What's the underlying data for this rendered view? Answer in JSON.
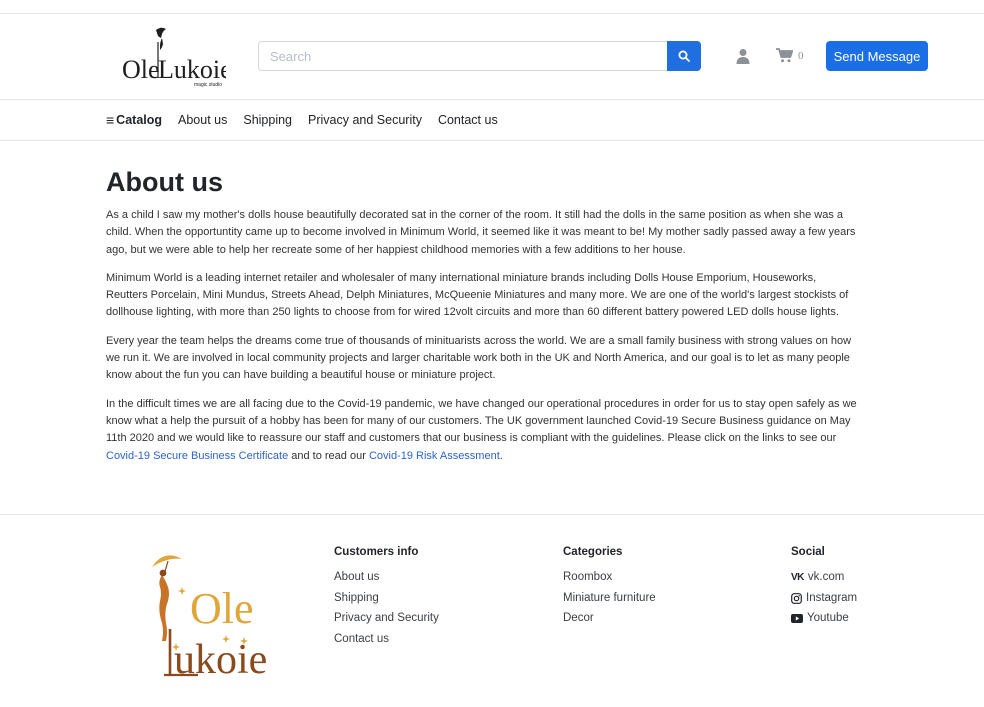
{
  "header": {
    "logo_text": "Ole Lukoie",
    "logo_subtext": "magic studio",
    "search_placeholder": "Search",
    "cart_count": "0",
    "send_message_label": "Send Message"
  },
  "nav": {
    "items": [
      {
        "label": "Catalog"
      },
      {
        "label": "About us"
      },
      {
        "label": "Shipping"
      },
      {
        "label": "Privacy and Security"
      },
      {
        "label": "Contact us"
      }
    ]
  },
  "main": {
    "title": "About us",
    "paragraphs": [
      "As a child I saw my mother's dolls house beautifully decorated sat in the corner of the room. It still had the dolls in the same position as when she was a child. When the opportuntity came up to become involved in Minimum World, it seemed like it was meant to be! My mother sadly passed away a few years ago, but we were able to help her recreate some of her happiest childhood memories with a few additions to her house.",
      "Minimum World is a leading internet retailer and wholesaler of many international miniature brands including Dolls House Emporium, Houseworks, Reutters Porcelain, Mini Mundus, Streets Ahead, Delph Miniatures, McQueenie Miniatures and many more. We are one of the world's largest stockists of dollhouse lighting, with more than 250 lights to choose from for wired 12volt circuits and more than 60 different battery powered LED dolls house lights.",
      "Every year the team helps the dreams come true of thousands of minituarists across the world. We are a small family business with strong values on how we run it. We are involved in local community projects and larger charitable work both in the UK and North America, and our goal is to let as many people know about the fun you can have building a beautiful house or miniature project."
    ],
    "last_paragraph": {
      "text_before": "In the difficult times we are all facing due to the Covid-19 pandemic, we have changed our operational procedures in order for us to stay open safely as we know what a help the pursuit of a hobby has been for many of our customers. The UK government launched Covid-19 Secure Business guidance on May 11th 2020 and we would like to reassure our staff and customers that our business is compliant with the guidelines. Please click on the links to see our ",
      "link1": "Covid-19 Secure Business Certificate",
      "text_middle": " and to read our ",
      "link2": "Covid-19 Risk Assessment",
      "text_after": "."
    }
  },
  "footer": {
    "logo_text_top": "Ole",
    "logo_text_bottom": "Lukoie",
    "customers": {
      "title": "Customers info",
      "items": [
        "About us",
        "Shipping",
        "Privacy and Security",
        "Contact us"
      ]
    },
    "categories": {
      "title": "Categories",
      "items": [
        "Roombox",
        "Miniature furniture",
        "Decor"
      ]
    },
    "social": {
      "title": "Social",
      "items": [
        {
          "icon": "vk-icon",
          "label": "vk.com"
        },
        {
          "icon": "instagram-icon",
          "label": "Instagram"
        },
        {
          "icon": "youtube-icon",
          "label": "Youtube"
        }
      ]
    }
  },
  "colors": {
    "primary": "#1a6ee6",
    "link": "#2d63c8",
    "logo_gold": "#e0a63a",
    "logo_brown": "#8a4a1e"
  }
}
